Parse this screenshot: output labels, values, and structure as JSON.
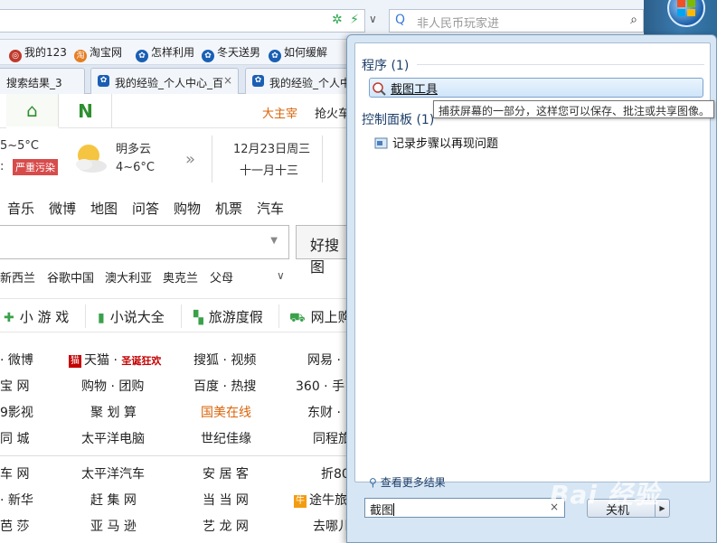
{
  "browser": {
    "search_placeholder": "非人民币玩家进",
    "favorites": [
      {
        "label": "我的123",
        "color": "#c0392b",
        "glyph": "◎"
      },
      {
        "label": "淘宝网",
        "color": "#e67e22",
        "glyph": "淘"
      },
      {
        "label": "怎样利用",
        "color": "#1a5fb4",
        "glyph": "✿"
      },
      {
        "label": "冬天送男",
        "color": "#1a5fb4",
        "glyph": "✿"
      },
      {
        "label": "如何缓解",
        "color": "#1a5fb4",
        "glyph": "✿"
      }
    ],
    "tabs": [
      {
        "label": "搜索结果_3"
      },
      {
        "label": "我的经验_个人中心_百"
      },
      {
        "label": "我的经验_个人中心"
      }
    ],
    "tab_close": "×"
  },
  "site": {
    "nav_link_1": "大主宰",
    "nav_link_2": "抢火车",
    "weather": {
      "temp_today": "5~5°C",
      "air_prefix": ":",
      "air_quality": "严重污染",
      "condition": "明多云",
      "temp_tomorrow": "4~6°C",
      "arrow": "»",
      "date": "12月23日周三",
      "lunar": "十一月十三"
    },
    "categories": [
      "音乐",
      "微博",
      "地图",
      "问答",
      "购物",
      "机票",
      "汽车"
    ],
    "search_button": "好搜图",
    "hot_words": [
      "新西兰",
      "谷歌中国",
      "澳大利亚",
      "奥克兰",
      "父母"
    ],
    "quick_links": [
      {
        "label": "小 游 戏",
        "icon": "gamepad-icon",
        "glyph": "🎮"
      },
      {
        "label": "小说大全",
        "icon": "book-icon",
        "glyph": "▮"
      },
      {
        "label": "旅游度假",
        "icon": "map-icon",
        "glyph": "▚"
      },
      {
        "label": "网上购",
        "icon": "cart-icon",
        "glyph": "🛒"
      }
    ],
    "links_rows": [
      [
        "· 微博",
        "天猫 ·",
        "搜狐 · 视频",
        "网易 ·"
      ],
      [
        "宝 网",
        "购物 · 团购",
        "百度 · 热搜",
        "360 · 手"
      ],
      [
        "9影视",
        "聚 划 算",
        "国美在线",
        "东财 ·"
      ],
      [
        "同 城",
        "太平洋电脑",
        "世纪佳缘",
        "同程旅"
      ],
      [
        "车 网",
        "太平洋汽车",
        "安 居 客",
        "折80"
      ],
      [
        "· 新华",
        "赶 集 网",
        "当 当 网",
        "途牛旅"
      ],
      [
        "芭 莎",
        "亚 马 逊",
        "艺 龙 网",
        "去哪儿"
      ]
    ],
    "tmall_badge": "猫",
    "tmall_promo": "圣诞狂欢",
    "tuniu_badge": "牛"
  },
  "start_menu": {
    "section_programs": "程序 (1)",
    "program_item": "截图工具",
    "section_control_panel": "控制面板 (1)",
    "control_panel_item": "记录步骤以再现问题",
    "tooltip": "捕获屏幕的一部分，这样您可以保存、批注或共享图像。",
    "see_more": "查看更多结果",
    "search_value": "截图",
    "clear": "×",
    "shutdown": "关机",
    "shutdown_arrow": "▶"
  },
  "watermark": "Bai 经验",
  "colors": {
    "accent_green": "#2d8f2d",
    "accent_orange": "#d9640a",
    "alert_red": "#d84b4b",
    "start_menu_bg": "#d7e6f4"
  }
}
